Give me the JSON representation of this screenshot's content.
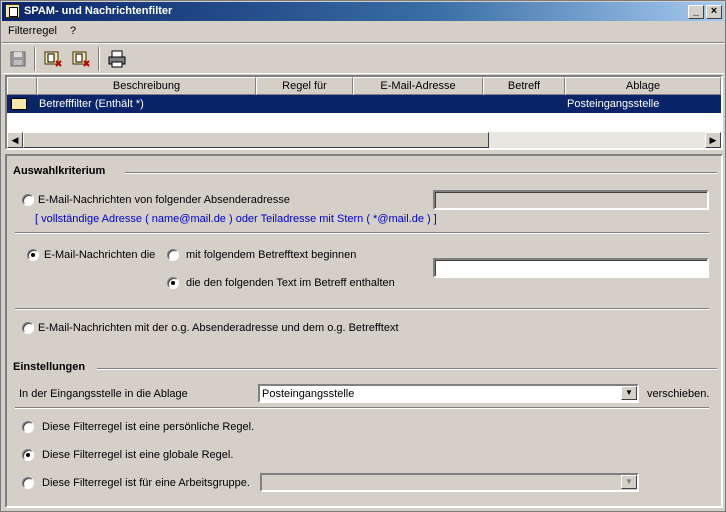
{
  "window": {
    "title": "SPAM- und Nachrichtenfilter"
  },
  "title_buttons": {
    "minimize": "_",
    "maximize": "□",
    "close": "×"
  },
  "menu": {
    "items": [
      "Filterregel",
      "?"
    ]
  },
  "toolbar": {
    "icons": [
      "save-icon",
      "new-rule-icon",
      "delete-rule-icon",
      "print-icon"
    ]
  },
  "grid": {
    "columns": [
      "",
      "Beschreibung",
      "Regel für",
      "E-Mail-Adresse",
      "Betreff",
      "Ablage"
    ],
    "rows": [
      {
        "beschreibung": "Betrefffilter (Enthält *)",
        "regel_fuer": "",
        "email": "",
        "betreff": "",
        "ablage": "Posteingangsstelle"
      }
    ]
  },
  "auswahl": {
    "title": "Auswahlkriterium",
    "option_sender": "E-Mail-Nachrichten von folgender Absenderadresse",
    "sender_value": "",
    "sender_hint": "[ vollständige Adresse ( name@mail.de ) oder Teiladresse mit Stern ( *@mail.de ) ]",
    "option_subject": "E-Mail-Nachrichten die",
    "sub_begin": "mit folgendem Betrefftext beginnen",
    "sub_contains": "die den folgenden Text im Betreff enthalten",
    "subject_value": "",
    "option_both": "E-Mail-Nachrichten mit der o.g. Absenderadresse und dem o.g. Betrefftext",
    "selected_option": "subject",
    "selected_sub": "contains"
  },
  "einstellungen": {
    "title": "Einstellungen",
    "move_label": "In der Eingangsstelle in die Ablage",
    "move_value": "Posteingangsstelle",
    "move_suffix": "verschieben.",
    "rule_personal": "Diese Filterregel ist eine persönliche Regel.",
    "rule_global": "Diese Filterregel ist eine globale Regel.",
    "rule_group": "Diese Filterregel ist für eine Arbeitsgruppe.",
    "group_value": "",
    "selected_rule": "global"
  },
  "colors": {
    "title_bar": "#0a246a",
    "selected_row": "#0a246a",
    "hint_text": "#0000cc",
    "face": "#d4d0c8"
  }
}
